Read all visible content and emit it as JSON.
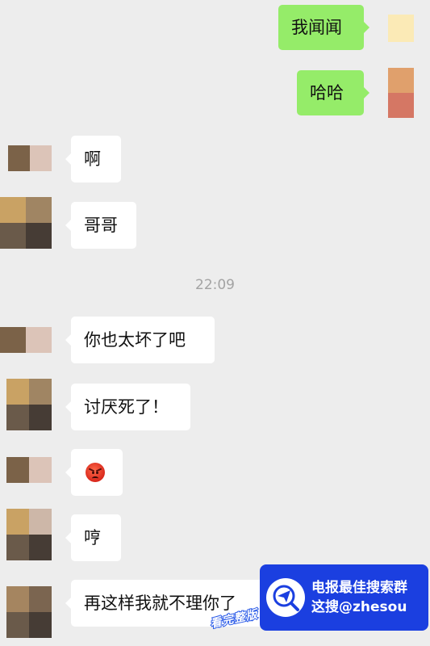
{
  "chat": {
    "timestamp": "22:09",
    "messages": [
      {
        "side": "out",
        "text": "我闻闻"
      },
      {
        "side": "out",
        "text": "哈哈"
      },
      {
        "side": "in",
        "text": "啊"
      },
      {
        "side": "in",
        "text": "哥哥"
      },
      {
        "side": "in",
        "text": "你也太坏了吧"
      },
      {
        "side": "in",
        "text": "讨厌死了！"
      },
      {
        "side": "in",
        "icon": "angry-face-emoji"
      },
      {
        "side": "in",
        "text": "哼"
      },
      {
        "side": "in",
        "text": "再这样我就不理你了"
      }
    ]
  },
  "banner": {
    "line1": "电报最佳搜索群",
    "line2": "这搜@zhesou",
    "icon": "paper-plane-search-icon",
    "stamp": "看完整版"
  },
  "colors": {
    "background": "#ededed",
    "outgoing_bubble": "#95ec69",
    "incoming_bubble": "#ffffff",
    "banner": "#1b3fe0"
  }
}
